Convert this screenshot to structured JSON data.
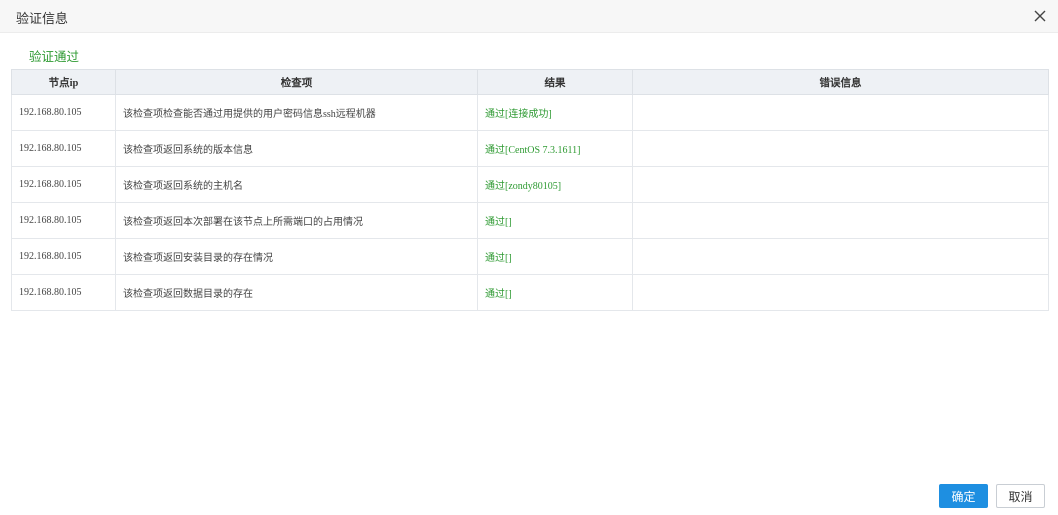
{
  "dialog": {
    "title": "验证信息",
    "close_icon": "close-icon",
    "status_text": "验证通过",
    "status_color": "#2e9a32"
  },
  "table": {
    "headers": [
      "节点ip",
      "检查项",
      "结果",
      "错误信息"
    ],
    "rows": [
      {
        "ip": "192.168.80.105",
        "item": "该检查项检查能否通过用提供的用户密码信息ssh远程机器",
        "result": "通过[连接成功]",
        "error": ""
      },
      {
        "ip": "192.168.80.105",
        "item": "该检查项返回系统的版本信息",
        "result": "通过[CentOS 7.3.1611]",
        "error": ""
      },
      {
        "ip": "192.168.80.105",
        "item": "该检查项返回系统的主机名",
        "result": "通过[zondy80105]",
        "error": ""
      },
      {
        "ip": "192.168.80.105",
        "item": "该检查项返回本次部署在该节点上所需端口的占用情况",
        "result": "通过[]",
        "error": ""
      },
      {
        "ip": "192.168.80.105",
        "item": "该检查项返回安装目录的存在情况",
        "result": "通过[]",
        "error": ""
      },
      {
        "ip": "192.168.80.105",
        "item": "该检查项返回数据目录的存在",
        "result": "通过[]",
        "error": ""
      }
    ]
  },
  "buttons": {
    "ok_label": "确定",
    "cancel_label": "取消",
    "primary_color": "#1e8fe1"
  }
}
